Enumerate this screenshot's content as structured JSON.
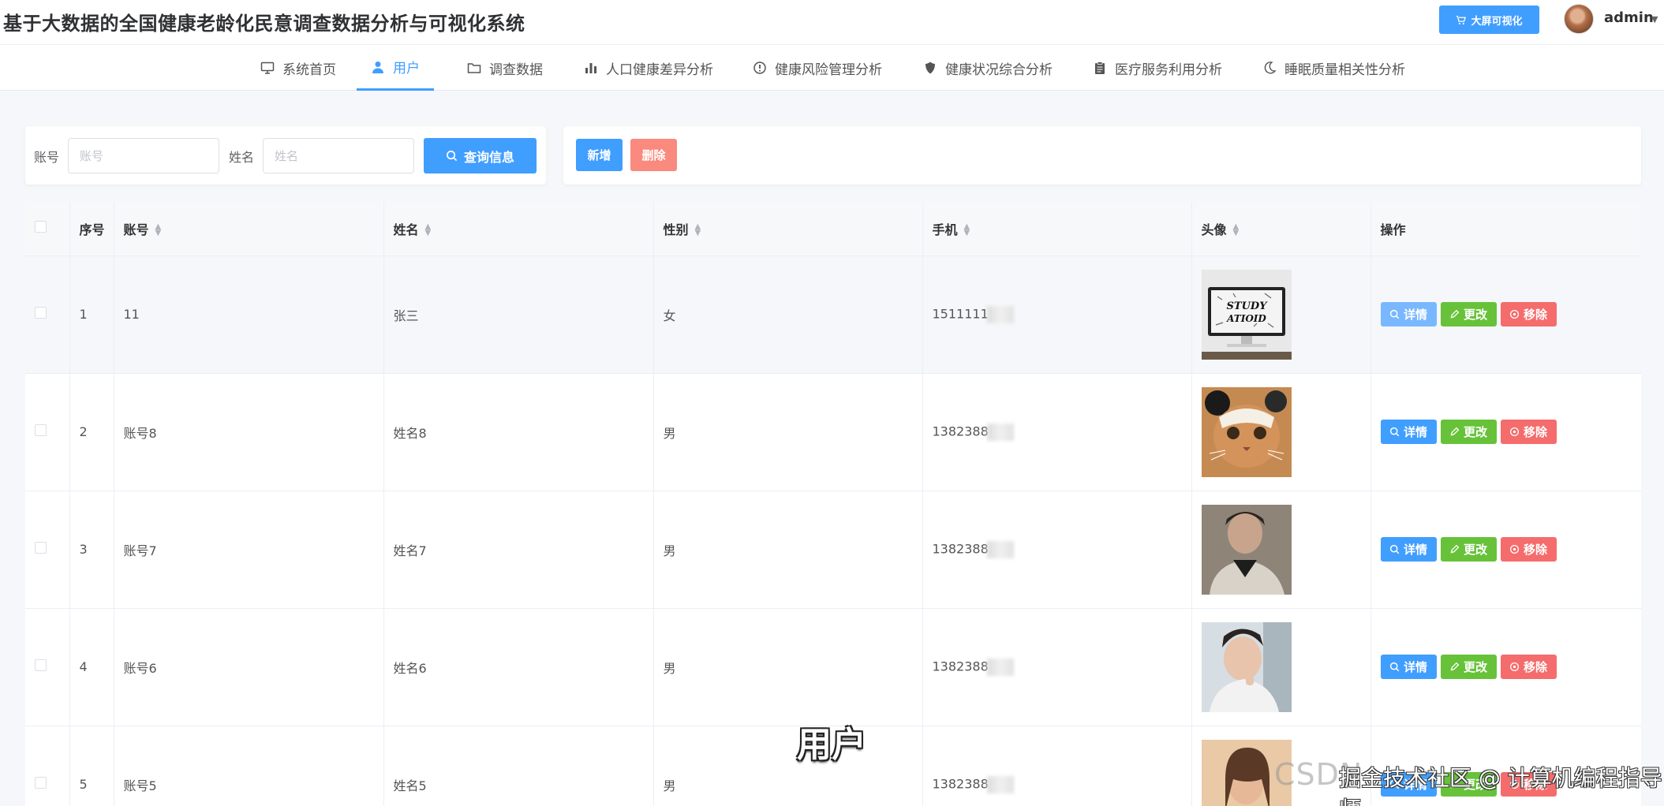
{
  "header": {
    "title": "基于大数据的全国健康老龄化民意调查数据分析与可视化系统",
    "bigscreen_label": "大屏可视化",
    "username": "admin",
    "caret": "⌄"
  },
  "nav": {
    "items": [
      {
        "label": "系统首页",
        "icon": "monitor-icon"
      },
      {
        "label": "用户",
        "icon": "user-icon",
        "active": true
      },
      {
        "label": "调查数据",
        "icon": "folder-icon"
      },
      {
        "label": "人口健康差异分析",
        "icon": "bar-chart-icon"
      },
      {
        "label": "健康风险管理分析",
        "icon": "alert-circle-icon"
      },
      {
        "label": "健康状况综合分析",
        "icon": "shield-icon"
      },
      {
        "label": "医疗服务利用分析",
        "icon": "clipboard-icon"
      },
      {
        "label": "睡眠质量相关性分析",
        "icon": "moon-icon"
      }
    ]
  },
  "search": {
    "account_label": "账号",
    "account_placeholder": "账号",
    "name_label": "姓名",
    "name_placeholder": "姓名",
    "query_label": "查询信息"
  },
  "actions": {
    "add_label": "新增",
    "delete_label": "删除"
  },
  "colors": {
    "primary": "#409eff",
    "success": "#67c23a",
    "danger": "#f56c6c",
    "delete_btn": "#f98a7d"
  },
  "table": {
    "headers": {
      "index": "序号",
      "account": "账号",
      "name": "姓名",
      "gender": "性别",
      "phone": "手机",
      "avatar": "头像",
      "ops": "操作"
    },
    "op_labels": {
      "detail": "详情",
      "edit": "更改",
      "remove": "移除"
    },
    "rows": [
      {
        "index": "1",
        "account": "11",
        "name": "张三",
        "gender": "女",
        "phone": "1511111",
        "avatar": "study-poster-image"
      },
      {
        "index": "2",
        "account": "账号8",
        "name": "姓名8",
        "gender": "男",
        "phone": "1382388",
        "avatar": "cat-image"
      },
      {
        "index": "3",
        "account": "账号7",
        "name": "姓名7",
        "gender": "男",
        "phone": "1382388",
        "avatar": "man-portrait-image"
      },
      {
        "index": "4",
        "account": "账号6",
        "name": "姓名6",
        "gender": "男",
        "phone": "1382388",
        "avatar": "man-selfie-image"
      },
      {
        "index": "5",
        "account": "账号5",
        "name": "姓名5",
        "gender": "男",
        "phone": "1382388",
        "avatar": "woman-portrait-image"
      }
    ]
  },
  "overlay": {
    "caption": "用户",
    "watermark": "CSDN",
    "watermark2": "掘金技术社区 @ 计算机编程指导师"
  }
}
